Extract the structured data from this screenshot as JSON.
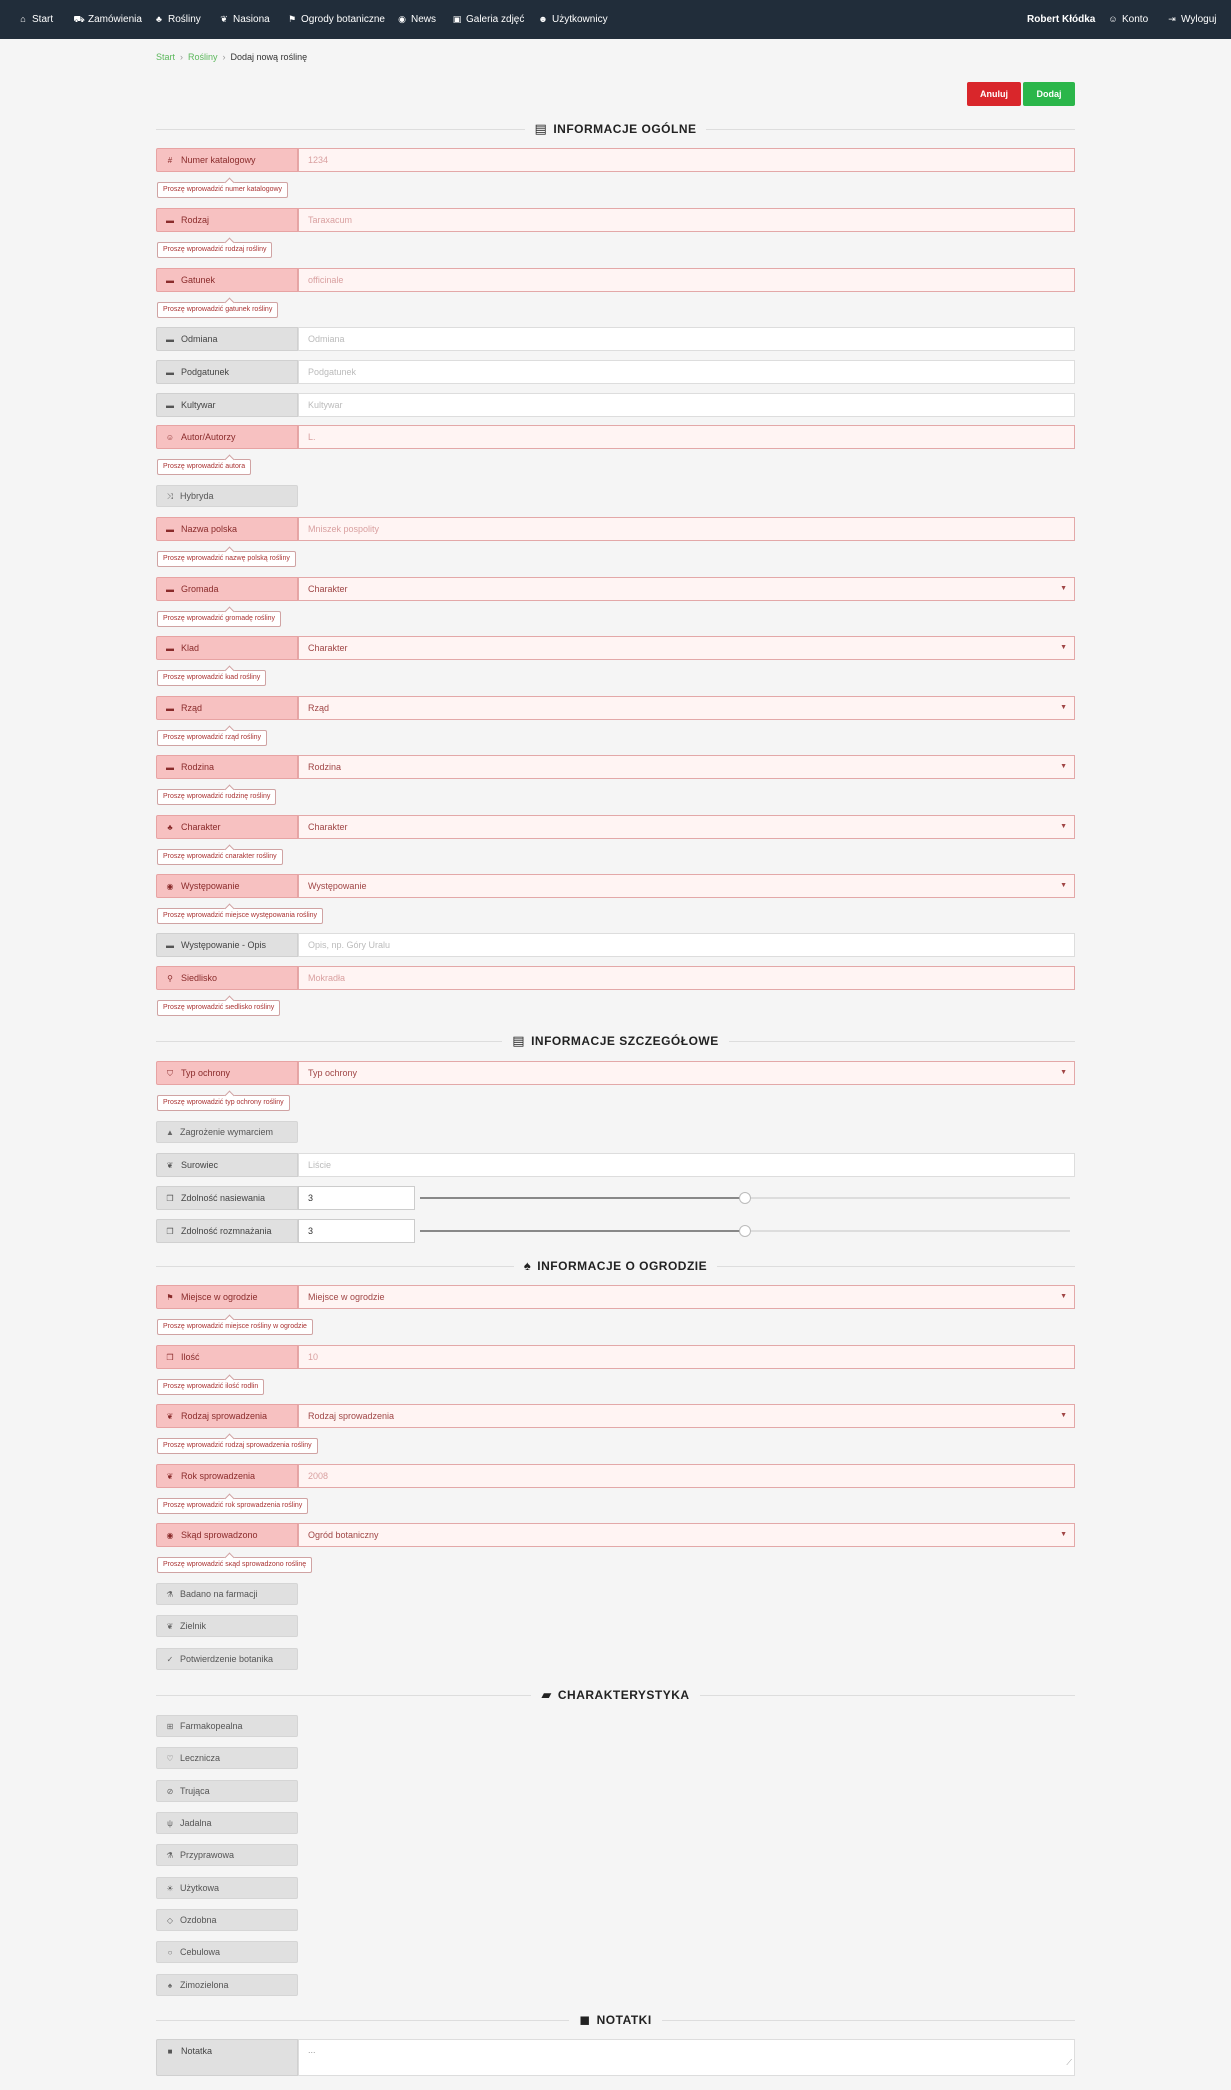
{
  "nav": {
    "left": [
      {
        "label": "Start",
        "icon": "home-icon",
        "glyph": "⌂"
      },
      {
        "label": "Zamówienia",
        "icon": "cart-icon",
        "glyph": "⛟"
      },
      {
        "label": "Rośliny",
        "icon": "plant-icon",
        "glyph": "♣"
      },
      {
        "label": "Nasiona",
        "icon": "leaf-icon",
        "glyph": "❦"
      },
      {
        "label": "Ogrody botaniczne",
        "icon": "signpost-icon",
        "glyph": "⚑"
      },
      {
        "label": "News",
        "icon": "globe-icon",
        "glyph": "◉"
      },
      {
        "label": "Galeria zdjęć",
        "icon": "image-icon",
        "glyph": "▣"
      },
      {
        "label": "Użytkownicy",
        "icon": "users-icon",
        "glyph": "☻"
      }
    ],
    "user_name": "Robert Kłódka",
    "account": {
      "label": "Konto",
      "icon": "user-icon",
      "glyph": "☺"
    },
    "logout": {
      "label": "Wyloguj",
      "icon": "logout-icon",
      "glyph": "⇥"
    }
  },
  "breadcrumb": {
    "home": "Start",
    "plants": "Rośliny",
    "current": "Dodaj nową roślinę",
    "sep": "›"
  },
  "buttons": {
    "cancel": "Anuluj",
    "add": "Dodaj",
    "cancel_color": "#d9262b",
    "add_color": "#2bb64a"
  },
  "sections": {
    "general": {
      "title": "INFORMACJE OGÓLNE",
      "icon": "list-icon",
      "glyph": "▤"
    },
    "details": {
      "title": "INFORMACJE SZCZEGÓŁOWE",
      "icon": "list-icon",
      "glyph": "▤"
    },
    "garden": {
      "title": "INFORMACJE O OGRODZIE",
      "icon": "tree-icon",
      "glyph": "♠"
    },
    "traits": {
      "title": "CHARAKTERYSTYKA",
      "icon": "book-icon",
      "glyph": "▰"
    },
    "notes": {
      "title": "NOTATKI",
      "icon": "note-icon",
      "glyph": "◼"
    }
  },
  "general_fields": [
    {
      "label": "Numer katalogowy",
      "icon": "hash-icon",
      "glyph": "#",
      "placeholder": "1234",
      "error": "Proszę wprowadzić numer katalogowy"
    },
    {
      "label": "Rodzaj",
      "icon": "card-icon",
      "glyph": "▬",
      "placeholder": "Taraxacum",
      "error": "Proszę wprowadzić rodzaj rośliny"
    },
    {
      "label": "Gatunek",
      "icon": "card-icon",
      "glyph": "▬",
      "placeholder": "officinale",
      "error": "Proszę wprowadzić gatunek rośliny"
    },
    {
      "label": "Odmiana",
      "icon": "card-icon",
      "glyph": "▬",
      "placeholder": "Odmiana"
    },
    {
      "label": "Podgatunek",
      "icon": "card-icon",
      "glyph": "▬",
      "placeholder": "Podgatunek"
    },
    {
      "label": "Kultywar",
      "icon": "card-icon",
      "glyph": "▬",
      "placeholder": "Kultywar"
    },
    {
      "label": "Autor/Autorzy",
      "icon": "user-icon",
      "glyph": "☺",
      "placeholder": "L.",
      "error": "Proszę wprowadzić autora"
    },
    {
      "label": "Hybryda",
      "icon": "shuffle-icon",
      "glyph": "⤨",
      "checkbox": true
    },
    {
      "label": "Nazwa polska",
      "icon": "card-icon",
      "glyph": "▬",
      "placeholder": "Mniszek pospolity",
      "error": "Proszę wprowadzić nazwę polską rośliny"
    },
    {
      "label": "Gromada",
      "icon": "card-icon",
      "glyph": "▬",
      "select": "Charakter",
      "error": "Proszę wprowadzić gromadę rośliny"
    },
    {
      "label": "Klad",
      "icon": "card-icon",
      "glyph": "▬",
      "select": "Charakter",
      "error": "Proszę wprowadzić klad rośliny"
    },
    {
      "label": "Rząd",
      "icon": "card-icon",
      "glyph": "▬",
      "select": "Rząd",
      "error": "Proszę wprowadzić rząd rośliny"
    },
    {
      "label": "Rodzina",
      "icon": "card-icon",
      "glyph": "▬",
      "select": "Rodzina",
      "error": "Proszę wprowadzić rodzinę rośliny"
    },
    {
      "label": "Charakter",
      "icon": "plant-icon",
      "glyph": "♣",
      "select": "Charakter",
      "error": "Proszę wprowadzić charakter rośliny"
    },
    {
      "label": "Występowanie",
      "icon": "globe-icon",
      "glyph": "◉",
      "select": "Występowanie",
      "error": "Proszę wprowadzić miejsce występowania rośliny"
    },
    {
      "label": "Występowanie - Opis",
      "icon": "card-icon",
      "glyph": "▬",
      "placeholder": "Opis, np. Góry Uralu"
    },
    {
      "label": "Siedlisko",
      "icon": "pin-icon",
      "glyph": "⚲",
      "placeholder": "Mokradła",
      "error": "Proszę wprowadzić siedlisko rośliny"
    }
  ],
  "details_fields": {
    "protection": {
      "label": "Typ ochrony",
      "icon": "shield-icon",
      "glyph": "⛉",
      "select": "Typ ochrony",
      "error": "Proszę wprowadzić typ ochrony rośliny"
    },
    "endangered": {
      "label": "Zagrożenie wymarciem",
      "icon": "warning-icon",
      "glyph": "▲"
    },
    "raw": {
      "label": "Surowiec",
      "icon": "leaf-icon",
      "glyph": "❦",
      "placeholder": "Liście"
    },
    "sowing": {
      "label": "Zdolność nasiewania",
      "icon": "cubes-icon",
      "glyph": "❒",
      "value": "3",
      "level": 0.5
    },
    "propagation": {
      "label": "Zdolność rozmnażania",
      "icon": "cubes-icon",
      "glyph": "❒",
      "value": "3",
      "level": 0.5
    }
  },
  "garden_fields": [
    {
      "label": "Miejsce w ogrodzie",
      "icon": "signpost-icon",
      "glyph": "⚑",
      "select": "Miejsce w ogrodzie",
      "error": "Proszę wprowadzić miejsce rośliny w ogrodzie"
    },
    {
      "label": "Ilość",
      "icon": "cubes-icon",
      "glyph": "❒",
      "placeholder": "10",
      "error": "Proszę wprowadzić ilość rodlin"
    },
    {
      "label": "Rodzaj sprowadzenia",
      "icon": "leaf-icon",
      "glyph": "❦",
      "select": "Rodzaj sprowadzenia",
      "error": "Proszę wprowadzić rodzaj sprowadzenia rośliny"
    },
    {
      "label": "Rok sprowadzenia",
      "icon": "leaf-icon",
      "glyph": "❦",
      "placeholder": "2008",
      "error": "Proszę wprowadzić rok sprowadzenia rośliny"
    },
    {
      "label": "Skąd sprowadzono",
      "icon": "globe-icon",
      "glyph": "◉",
      "select": "Ogród botaniczny",
      "error": "Proszę wprowadzić skąd sprowadzono roślinę"
    }
  ],
  "garden_checks": [
    {
      "label": "Badano na farmacji",
      "icon": "flask-icon",
      "glyph": "⚗"
    },
    {
      "label": "Zielnik",
      "icon": "leaf-icon",
      "glyph": "❦"
    },
    {
      "label": "Potwierdzenie botanika",
      "icon": "check-icon",
      "glyph": "✓"
    }
  ],
  "traits": [
    {
      "label": "Farmakopealna",
      "icon": "medkit-icon",
      "glyph": "⊞"
    },
    {
      "label": "Lecznicza",
      "icon": "stethoscope-icon",
      "glyph": "♡"
    },
    {
      "label": "Trująca",
      "icon": "ban-icon",
      "glyph": "⊘"
    },
    {
      "label": "Jadalna",
      "icon": "cutlery-icon",
      "glyph": "ψ"
    },
    {
      "label": "Przyprawowa",
      "icon": "flask-icon",
      "glyph": "⚗"
    },
    {
      "label": "Użytkowa",
      "icon": "lightbulb-icon",
      "glyph": "☀"
    },
    {
      "label": "Ozdobna",
      "icon": "diamond-icon",
      "glyph": "◇"
    },
    {
      "label": "Cebulowa",
      "icon": "circle-icon",
      "glyph": "○"
    },
    {
      "label": "Zimozielona",
      "icon": "tree-icon",
      "glyph": "♠"
    }
  ],
  "note": {
    "label": "Notatka",
    "icon": "note-icon",
    "glyph": "■",
    "placeholder": "...",
    "grip": "⟋"
  }
}
